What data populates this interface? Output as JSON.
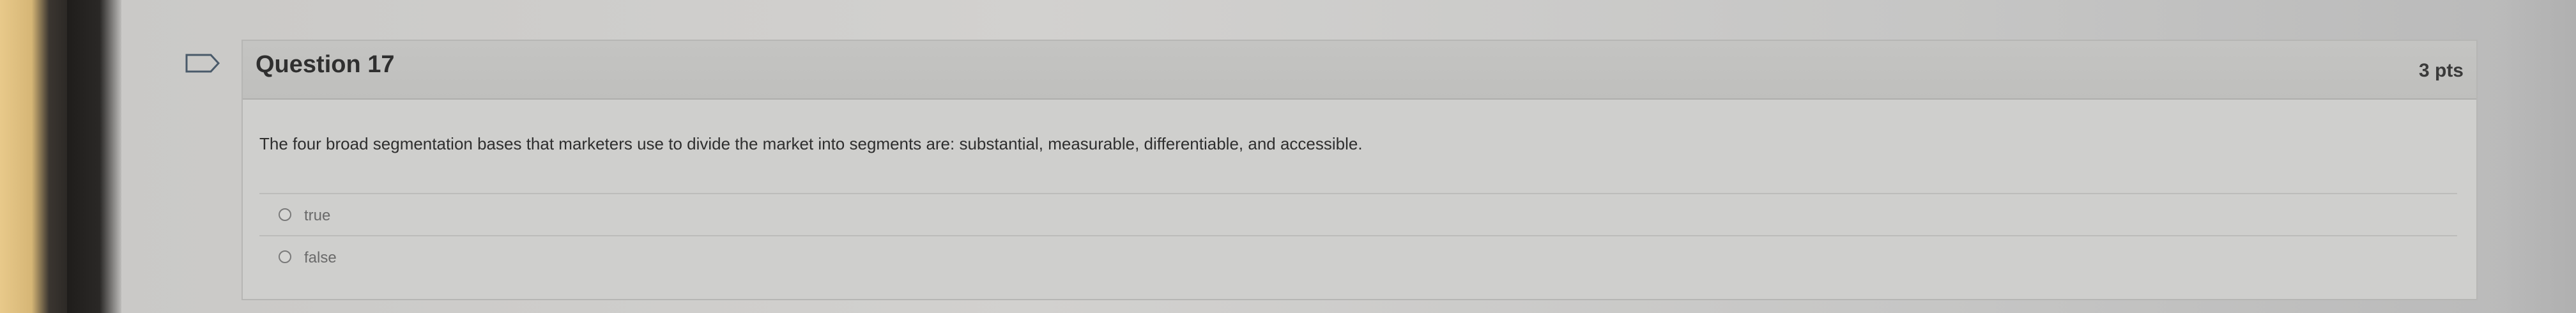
{
  "question": {
    "title": "Question 17",
    "points": "3 pts",
    "text": "The four broad segmentation bases that marketers use to divide the market into segments are: substantial, measurable, differentiable, and accessible.",
    "answers": [
      {
        "label": "true",
        "selected": false
      },
      {
        "label": "false",
        "selected": false
      }
    ]
  },
  "icons": {
    "flag": "bookmark-flag-icon"
  }
}
